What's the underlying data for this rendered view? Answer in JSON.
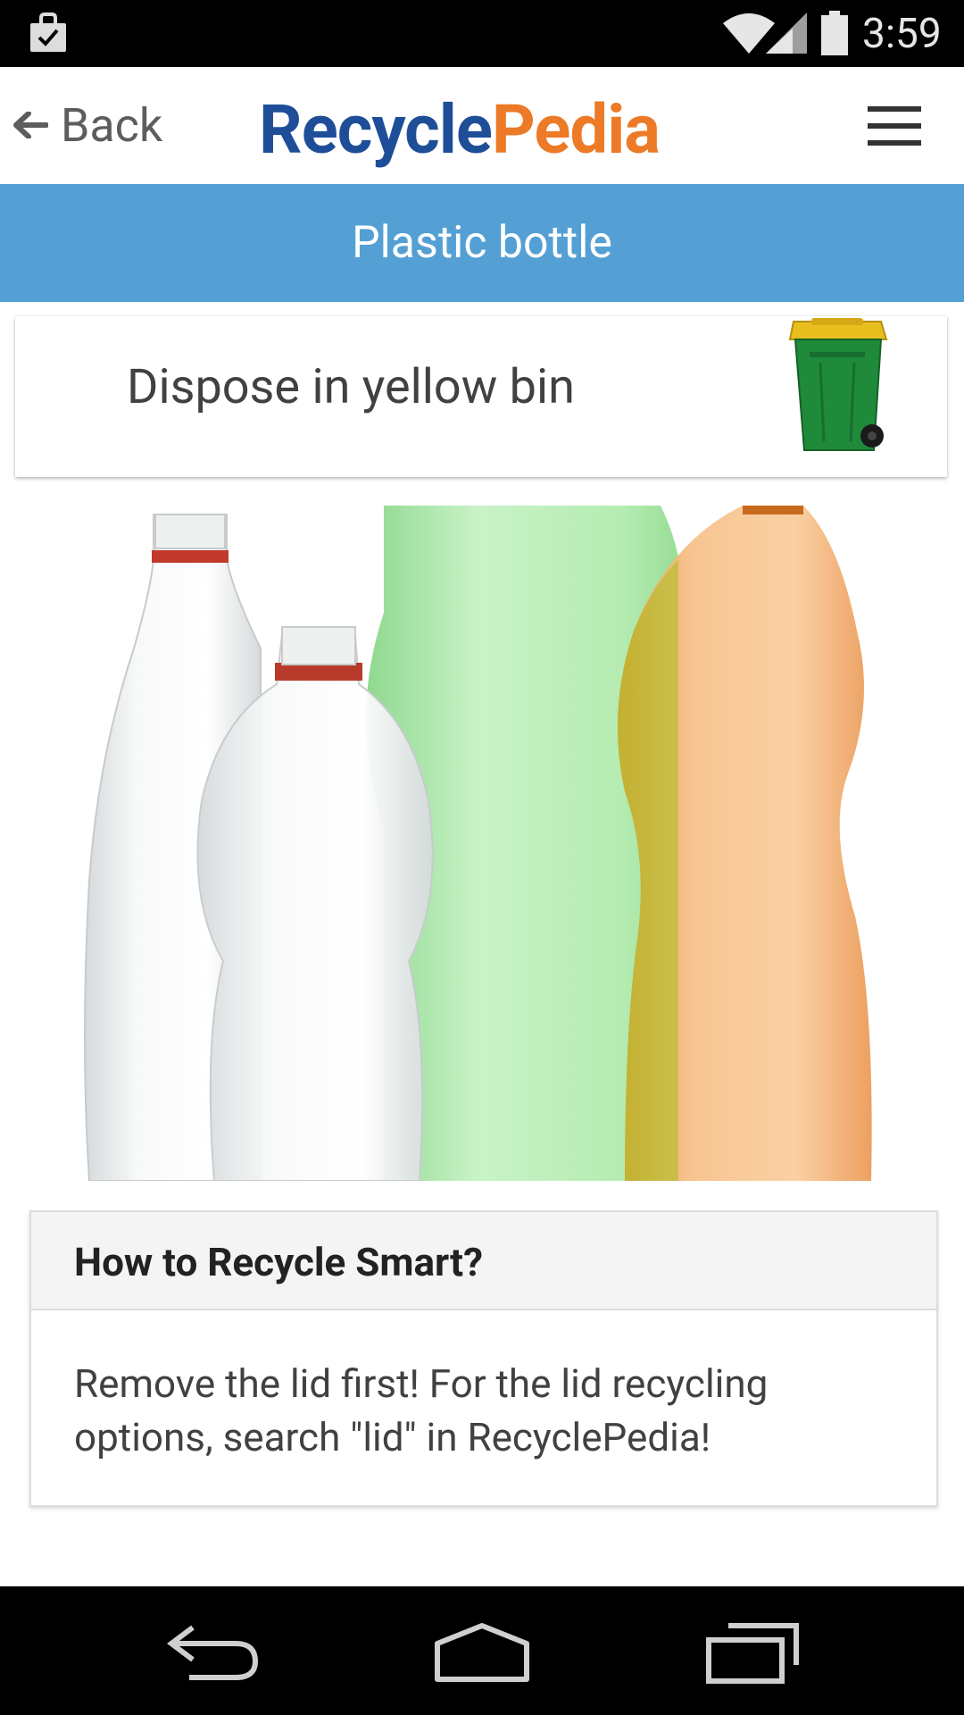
{
  "status_bar": {
    "time": "3:59",
    "icons": [
      "bag-check-icon",
      "wifi-icon",
      "cell-signal-icon",
      "battery-icon"
    ]
  },
  "header": {
    "back_label": "Back",
    "logo_part1": "Recycle",
    "logo_part2": "Pedia",
    "logo_colors": {
      "recycle": "#1f4e99",
      "pedia": "#ec7a27"
    }
  },
  "title_bar": {
    "title": "Plastic bottle",
    "color": "#549fd3"
  },
  "dispose": {
    "text": "Dispose in yellow bin",
    "bin_icon": "yellow-lid-wheelie-bin-icon"
  },
  "tip": {
    "title": "How to Recycle Smart?",
    "body": "Remove the lid first! For the lid recycling options, search \"lid\" in RecyclePedia!"
  },
  "nav_bar": {
    "buttons": [
      "back-icon",
      "home-icon",
      "recents-icon"
    ]
  }
}
